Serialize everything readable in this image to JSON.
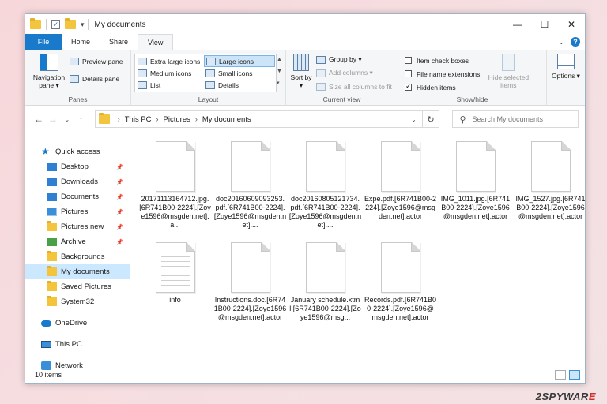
{
  "window": {
    "title": "My documents",
    "caption": {
      "minimize": "—",
      "maximize": "☐",
      "close": "✕"
    }
  },
  "ribbon_tabs": {
    "file": "File",
    "home": "Home",
    "share": "Share",
    "view": "View"
  },
  "ribbon": {
    "panes": {
      "navigation_pane": "Navigation pane ▾",
      "preview_pane": "Preview pane",
      "details_pane": "Details pane",
      "label": "Panes"
    },
    "layout": {
      "items": [
        "Extra large icons",
        "Large icons",
        "Medium icons",
        "Small icons",
        "List",
        "Details"
      ],
      "selected": "Large icons",
      "label": "Layout"
    },
    "current_view": {
      "sort_by": "Sort by ▾",
      "group_by": "Group by ▾",
      "add_columns": "Add columns ▾",
      "size_all_columns": "Size all columns to fit",
      "label": "Current view"
    },
    "show_hide": {
      "item_check_boxes": "Item check boxes",
      "file_name_extensions": "File name extensions",
      "hidden_items": "Hidden items",
      "hidden_items_checked": true,
      "hide_selected": "Hide selected items",
      "label": "Show/hide"
    },
    "options": "Options ▾"
  },
  "address": {
    "crumbs": [
      "This PC",
      "Pictures",
      "My documents"
    ],
    "search_placeholder": "Search My documents"
  },
  "nav_pane": {
    "quick_access": "Quick access",
    "quick_items": [
      {
        "label": "Desktop",
        "icon": "blue",
        "pinned": true
      },
      {
        "label": "Downloads",
        "icon": "blue",
        "pinned": true
      },
      {
        "label": "Documents",
        "icon": "blue",
        "pinned": true
      },
      {
        "label": "Pictures",
        "icon": "pic",
        "pinned": true
      },
      {
        "label": "Pictures new",
        "icon": "folder",
        "pinned": true
      },
      {
        "label": "Archive",
        "icon": "green",
        "pinned": true
      },
      {
        "label": "Backgrounds",
        "icon": "folder",
        "pinned": false
      },
      {
        "label": "My documents",
        "icon": "folder",
        "pinned": false,
        "selected": true
      },
      {
        "label": "Saved Pictures",
        "icon": "folder",
        "pinned": false
      },
      {
        "label": "System32",
        "icon": "folder",
        "pinned": false
      }
    ],
    "onedrive": "OneDrive",
    "this_pc": "This PC",
    "network": "Network"
  },
  "files": [
    {
      "name": "20171113164712.jpg.[6R741B00-2224].[Zoye1596@msgden.net].a...",
      "lined": false
    },
    {
      "name": "doc20160609093253.pdf.[6R741B00-2224].[Zoye1596@msgden.net]....",
      "lined": false
    },
    {
      "name": "doc20160805121734.pdf.[6R741B00-2224].[Zoye1596@msgden.net]....",
      "lined": false
    },
    {
      "name": "Expe.pdf.[6R741B00-2224].[Zoye1596@msgden.net].actor",
      "lined": false
    },
    {
      "name": "IMG_1011.jpg.[6R741B00-2224].[Zoye1596@msgden.net].actor",
      "lined": false
    },
    {
      "name": "IMG_1527.jpg.[6R741B00-2224].[Zoye1596@msgden.net].actor",
      "lined": false
    },
    {
      "name": "info",
      "lined": true
    },
    {
      "name": "Instructions.doc.[6R741B00-2224].[Zoye1596@msgden.net].actor",
      "lined": false
    },
    {
      "name": "January schedule.xtml.[6R741B00-2224].[Zoye1596@msg...",
      "lined": false
    },
    {
      "name": "Records.pdf.[6R741B00-2224].[Zoye1596@msgden.net].actor",
      "lined": false
    }
  ],
  "status": {
    "count": "10 items"
  },
  "watermark": {
    "prefix": "2",
    "brand": "SPYWAR",
    "suffix": "E"
  }
}
